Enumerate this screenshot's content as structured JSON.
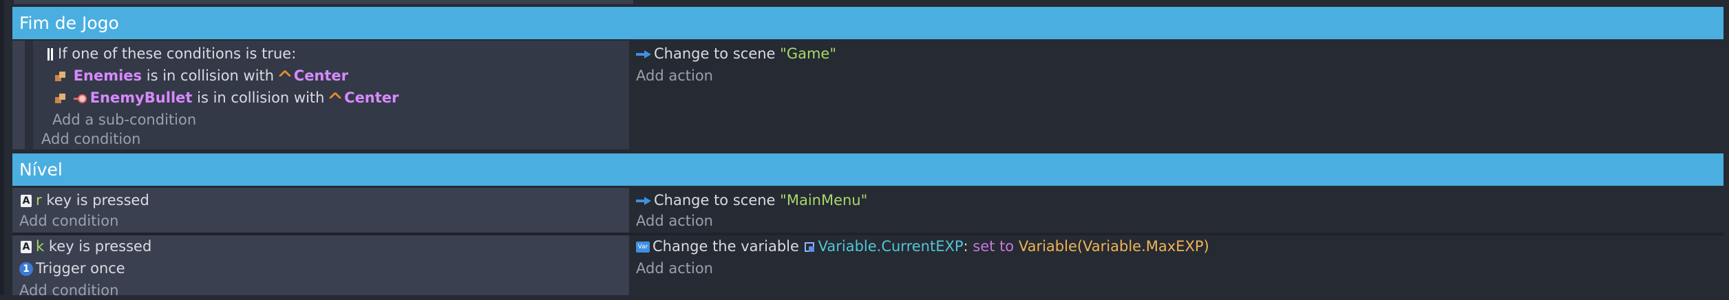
{
  "groups": {
    "fim_de_jogo": "Fim de Jogo",
    "nivel": "Nível"
  },
  "event1": {
    "or_label": "If one of these conditions is true:",
    "sub1": {
      "object": "Enemies",
      "text": "is in collision with",
      "target": "Center"
    },
    "sub2": {
      "object": "EnemyBullet",
      "text": "is in collision with",
      "target": "Center"
    },
    "add_sub_condition": "Add a sub-condition",
    "add_condition": "Add condition",
    "action": {
      "text": "Change to scene",
      "value": "\"Game\""
    },
    "add_action": "Add action"
  },
  "event2": {
    "key": "r",
    "cond_text": "key is pressed",
    "add_condition": "Add condition",
    "action": {
      "text": "Change to scene",
      "value": "\"MainMenu\""
    },
    "add_action": "Add action"
  },
  "event3": {
    "key": "k",
    "cond_text": "key is pressed",
    "trigger_once": "Trigger once",
    "add_condition": "Add condition",
    "action": {
      "text": "Change the variable",
      "variable": "Variable.CurrentEXP",
      "colon": ":",
      "op": "set to",
      "expr": "Variable(Variable.MaxEXP)"
    },
    "add_action": "Add action"
  },
  "icons": {
    "key_glyph": "A",
    "once_glyph": "1",
    "var_tag": "Var"
  },
  "colors": {
    "group_header": "#4baee0",
    "condition_bg": "#3b4050",
    "action_bg": "#262a33",
    "object_name": "#d78aff",
    "string_value": "#a6d96a",
    "variable_name": "#52c7d6",
    "expression": "#f0b554"
  }
}
